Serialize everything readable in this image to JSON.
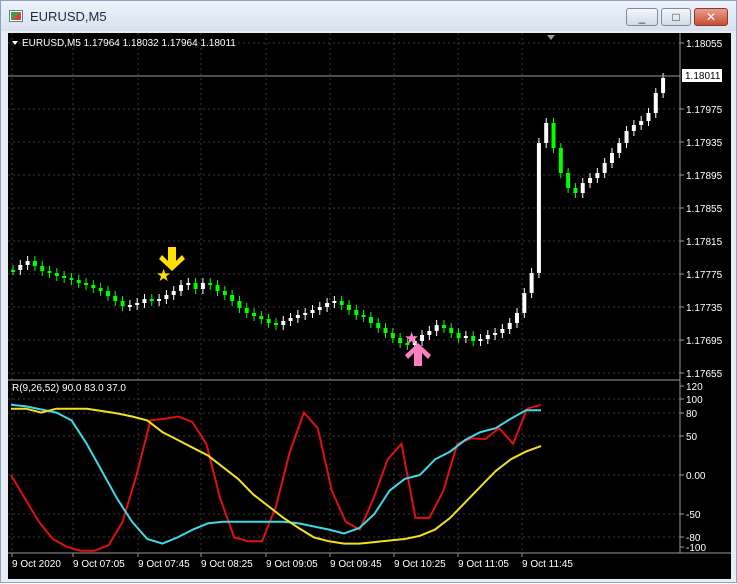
{
  "window": {
    "title": "EURUSD,M5",
    "buttons": [
      "_",
      "□",
      "✕"
    ]
  },
  "main_chart": {
    "header": "EURUSD,M5  1.17964 1.18032 1.17964 1.18011",
    "current_price_label": "1.18011",
    "price_ticks": [
      "1.18055",
      "1.17975",
      "1.17935",
      "1.17895",
      "1.17855",
      "1.17815",
      "1.17775",
      "1.17735",
      "1.17695",
      "1.17655"
    ]
  },
  "indicator": {
    "header": "R(9,26,52) 90.0 83.0 37.0",
    "ticks": [
      "120",
      "100",
      "80",
      "50",
      "0.00",
      "-50",
      "-80",
      "-100"
    ]
  },
  "time_axis": [
    "9 Oct 2020",
    "9 Oct 07:05",
    "9 Oct 07:45",
    "9 Oct 08:25",
    "9 Oct 09:05",
    "9 Oct 09:45",
    "9 Oct 10:25",
    "9 Oct 11:05",
    "9 Oct 11:45"
  ],
  "colors": {
    "bull": "#ffffff",
    "bear": "#00ff00",
    "grid": "#3a3a3a",
    "red_line": "#e01010",
    "cyan_line": "#40d8e8",
    "yellow_line": "#f0e020",
    "buy_marker": "#ff80c0",
    "sell_marker": "#ffe000"
  },
  "chart_data": {
    "type": "line",
    "series": [
      {
        "values": [
          0.05,
          -30,
          -60,
          -82,
          -92,
          -97,
          -97,
          -90,
          -60,
          0,
          70,
          72,
          75,
          68,
          40,
          -30,
          -80,
          -85,
          -85,
          -40,
          30,
          80,
          60,
          -20,
          -60,
          -70,
          -30,
          20,
          40,
          -55,
          -55,
          -20,
          40,
          47,
          46,
          60,
          40,
          85,
          90
        ]
      },
      {
        "values": [
          90,
          88,
          84,
          80,
          70,
          40,
          5,
          -30,
          -60,
          -82,
          -88,
          -80,
          -70,
          -62,
          -60,
          -60,
          -60,
          -60,
          -60,
          -62,
          -66,
          -70,
          -75,
          -68,
          -50,
          -20,
          -5,
          0,
          20,
          30,
          45,
          55,
          60,
          72,
          83,
          83
        ]
      },
      {
        "values": [
          85,
          85,
          80,
          85,
          85,
          85,
          82,
          79,
          75,
          70,
          55,
          45,
          35,
          25,
          10,
          -5,
          -25,
          -40,
          -55,
          -68,
          -80,
          -85,
          -88,
          -88,
          -86,
          -84,
          -82,
          -78,
          -70,
          -55,
          -35,
          -15,
          5,
          20,
          30,
          37
        ]
      }
    ]
  }
}
